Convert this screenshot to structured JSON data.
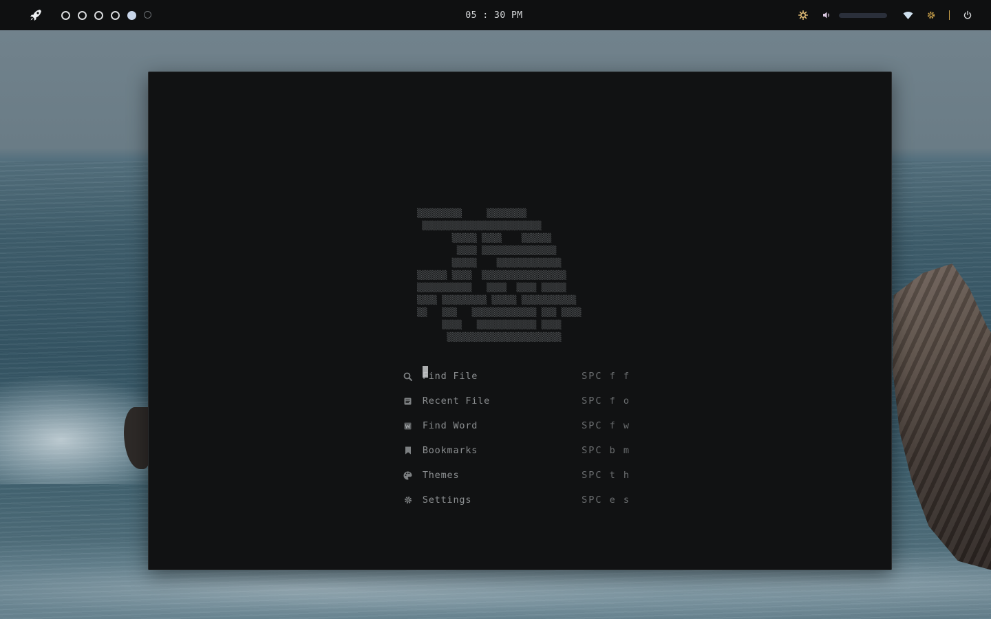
{
  "topbar": {
    "launcher_icon": "rocket-icon",
    "workspaces": [
      {
        "state": "empty"
      },
      {
        "state": "empty"
      },
      {
        "state": "empty"
      },
      {
        "state": "empty"
      },
      {
        "state": "active"
      },
      {
        "state": "dim"
      }
    ],
    "clock": "05 : 30 PM",
    "tray": {
      "brightness_icon": "brightness-icon",
      "volume_icon": "volume-icon",
      "volume_level": 0.0,
      "wifi_icon": "wifi-icon",
      "settings_icon": "gear-icon",
      "power_icon": "power-icon",
      "accent_color": "#caa14a"
    }
  },
  "editor": {
    "banner_art": "▒▒▒▒▒▒▒▒▒     ▒▒▒▒▒▒▒▒\n ▒▒▒▒▒▒▒▒▒▒▒▒▒▒▒▒▒▒▒▒▒▒▒▒\n       ▒▒▒▒▒ ▒▒▒▒    ▒▒▒▒▒▒\n        ▒▒▒▒ ▒▒▒▒▒▒▒▒▒▒▒▒▒▒▒\n       ▒▒▒▒▒    ▒▒▒▒▒▒▒▒▒▒▒▒▒\n▒▒▒▒▒▒ ▒▒▒▒  ▒▒▒▒▒▒▒▒▒▒▒▒▒▒▒▒▒\n▒▒▒▒▒▒▒▒▒▒▒   ▒▒▒▒  ▒▒▒▒ ▒▒▒▒▒\n▒▒▒▒ ▒▒▒▒▒▒▒▒▒ ▒▒▒▒▒ ▒▒▒▒▒▒▒▒▒▒▒\n▒▒   ▒▒▒   ▒▒▒▒▒▒▒▒▒▒▒▒▒ ▒▒▒ ▒▒▒▒\n     ▒▒▒▒   ▒▒▒▒▒▒▒▒▒▒▒▒ ▒▒▒▒\n      ▒▒▒▒▒▒▒▒▒▒▒▒▒▒▒▒▒▒▒▒▒▒▒",
    "menu": [
      {
        "icon": "search-icon",
        "label": "Find File",
        "key": "SPC f f"
      },
      {
        "icon": "file-icon",
        "label": "Recent File",
        "key": "SPC f o"
      },
      {
        "icon": "word-icon",
        "label": "Find Word",
        "key": "SPC f w"
      },
      {
        "icon": "bookmark-icon",
        "label": "Bookmarks",
        "key": "SPC b m"
      },
      {
        "icon": "palette-icon",
        "label": "Themes",
        "key": "SPC t h"
      },
      {
        "icon": "gear-icon",
        "label": "Settings",
        "key": "SPC e s"
      }
    ]
  }
}
